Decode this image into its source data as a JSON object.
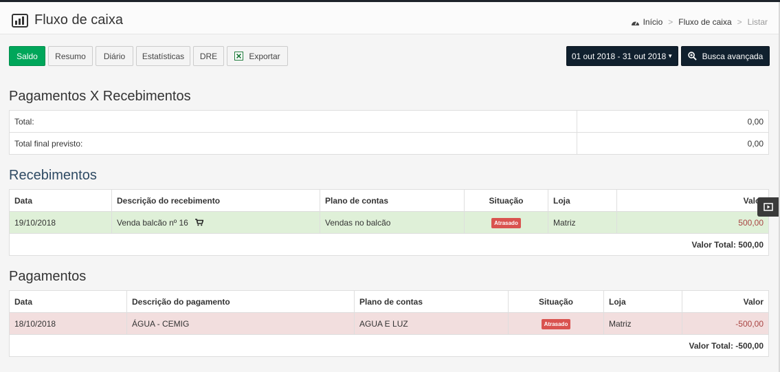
{
  "header": {
    "title": "Fluxo de caixa",
    "breadcrumb": [
      "Início",
      "Fluxo de caixa",
      "Listar"
    ]
  },
  "toolbar": {
    "tabs": [
      "Saldo",
      "Resumo",
      "Diário",
      "Estatísticas",
      "DRE"
    ],
    "export_label": "Exportar",
    "date_range": "01 out 2018 - 31 out 2018",
    "search_label": "Busca avançada"
  },
  "summary": {
    "title": "Pagamentos X Recebimentos",
    "rows": [
      {
        "label": "Total:",
        "value": "0,00"
      },
      {
        "label": "Total final previsto:",
        "value": "0,00"
      }
    ]
  },
  "receipts": {
    "title": "Recebimentos",
    "columns": [
      "Data",
      "Descrição do recebimento",
      "Plano de contas",
      "Situação",
      "Loja",
      "Valor"
    ],
    "rows": [
      {
        "date": "19/10/2018",
        "description": "Venda balcão nº 16",
        "plan": "Vendas no balcão",
        "status": "Atrasado",
        "store": "Matriz",
        "value": "500,00"
      }
    ],
    "total": "Valor Total: 500,00"
  },
  "payments": {
    "title": "Pagamentos",
    "columns": [
      "Data",
      "Descrição do pagamento",
      "Plano de contas",
      "Situação",
      "Loja",
      "Valor"
    ],
    "rows": [
      {
        "date": "18/10/2018",
        "description": "ÁGUA - CEMIG",
        "plan": "AGUA E LUZ",
        "status": "Atrasado",
        "store": "Matriz",
        "value": "-500,00"
      }
    ],
    "total": "Valor Total: -500,00"
  },
  "colors": {
    "green": "#00a65a",
    "dark": "#10202e",
    "badge_red": "#d9534f",
    "row_green": "#dff0d8",
    "row_red": "#f2dede"
  }
}
